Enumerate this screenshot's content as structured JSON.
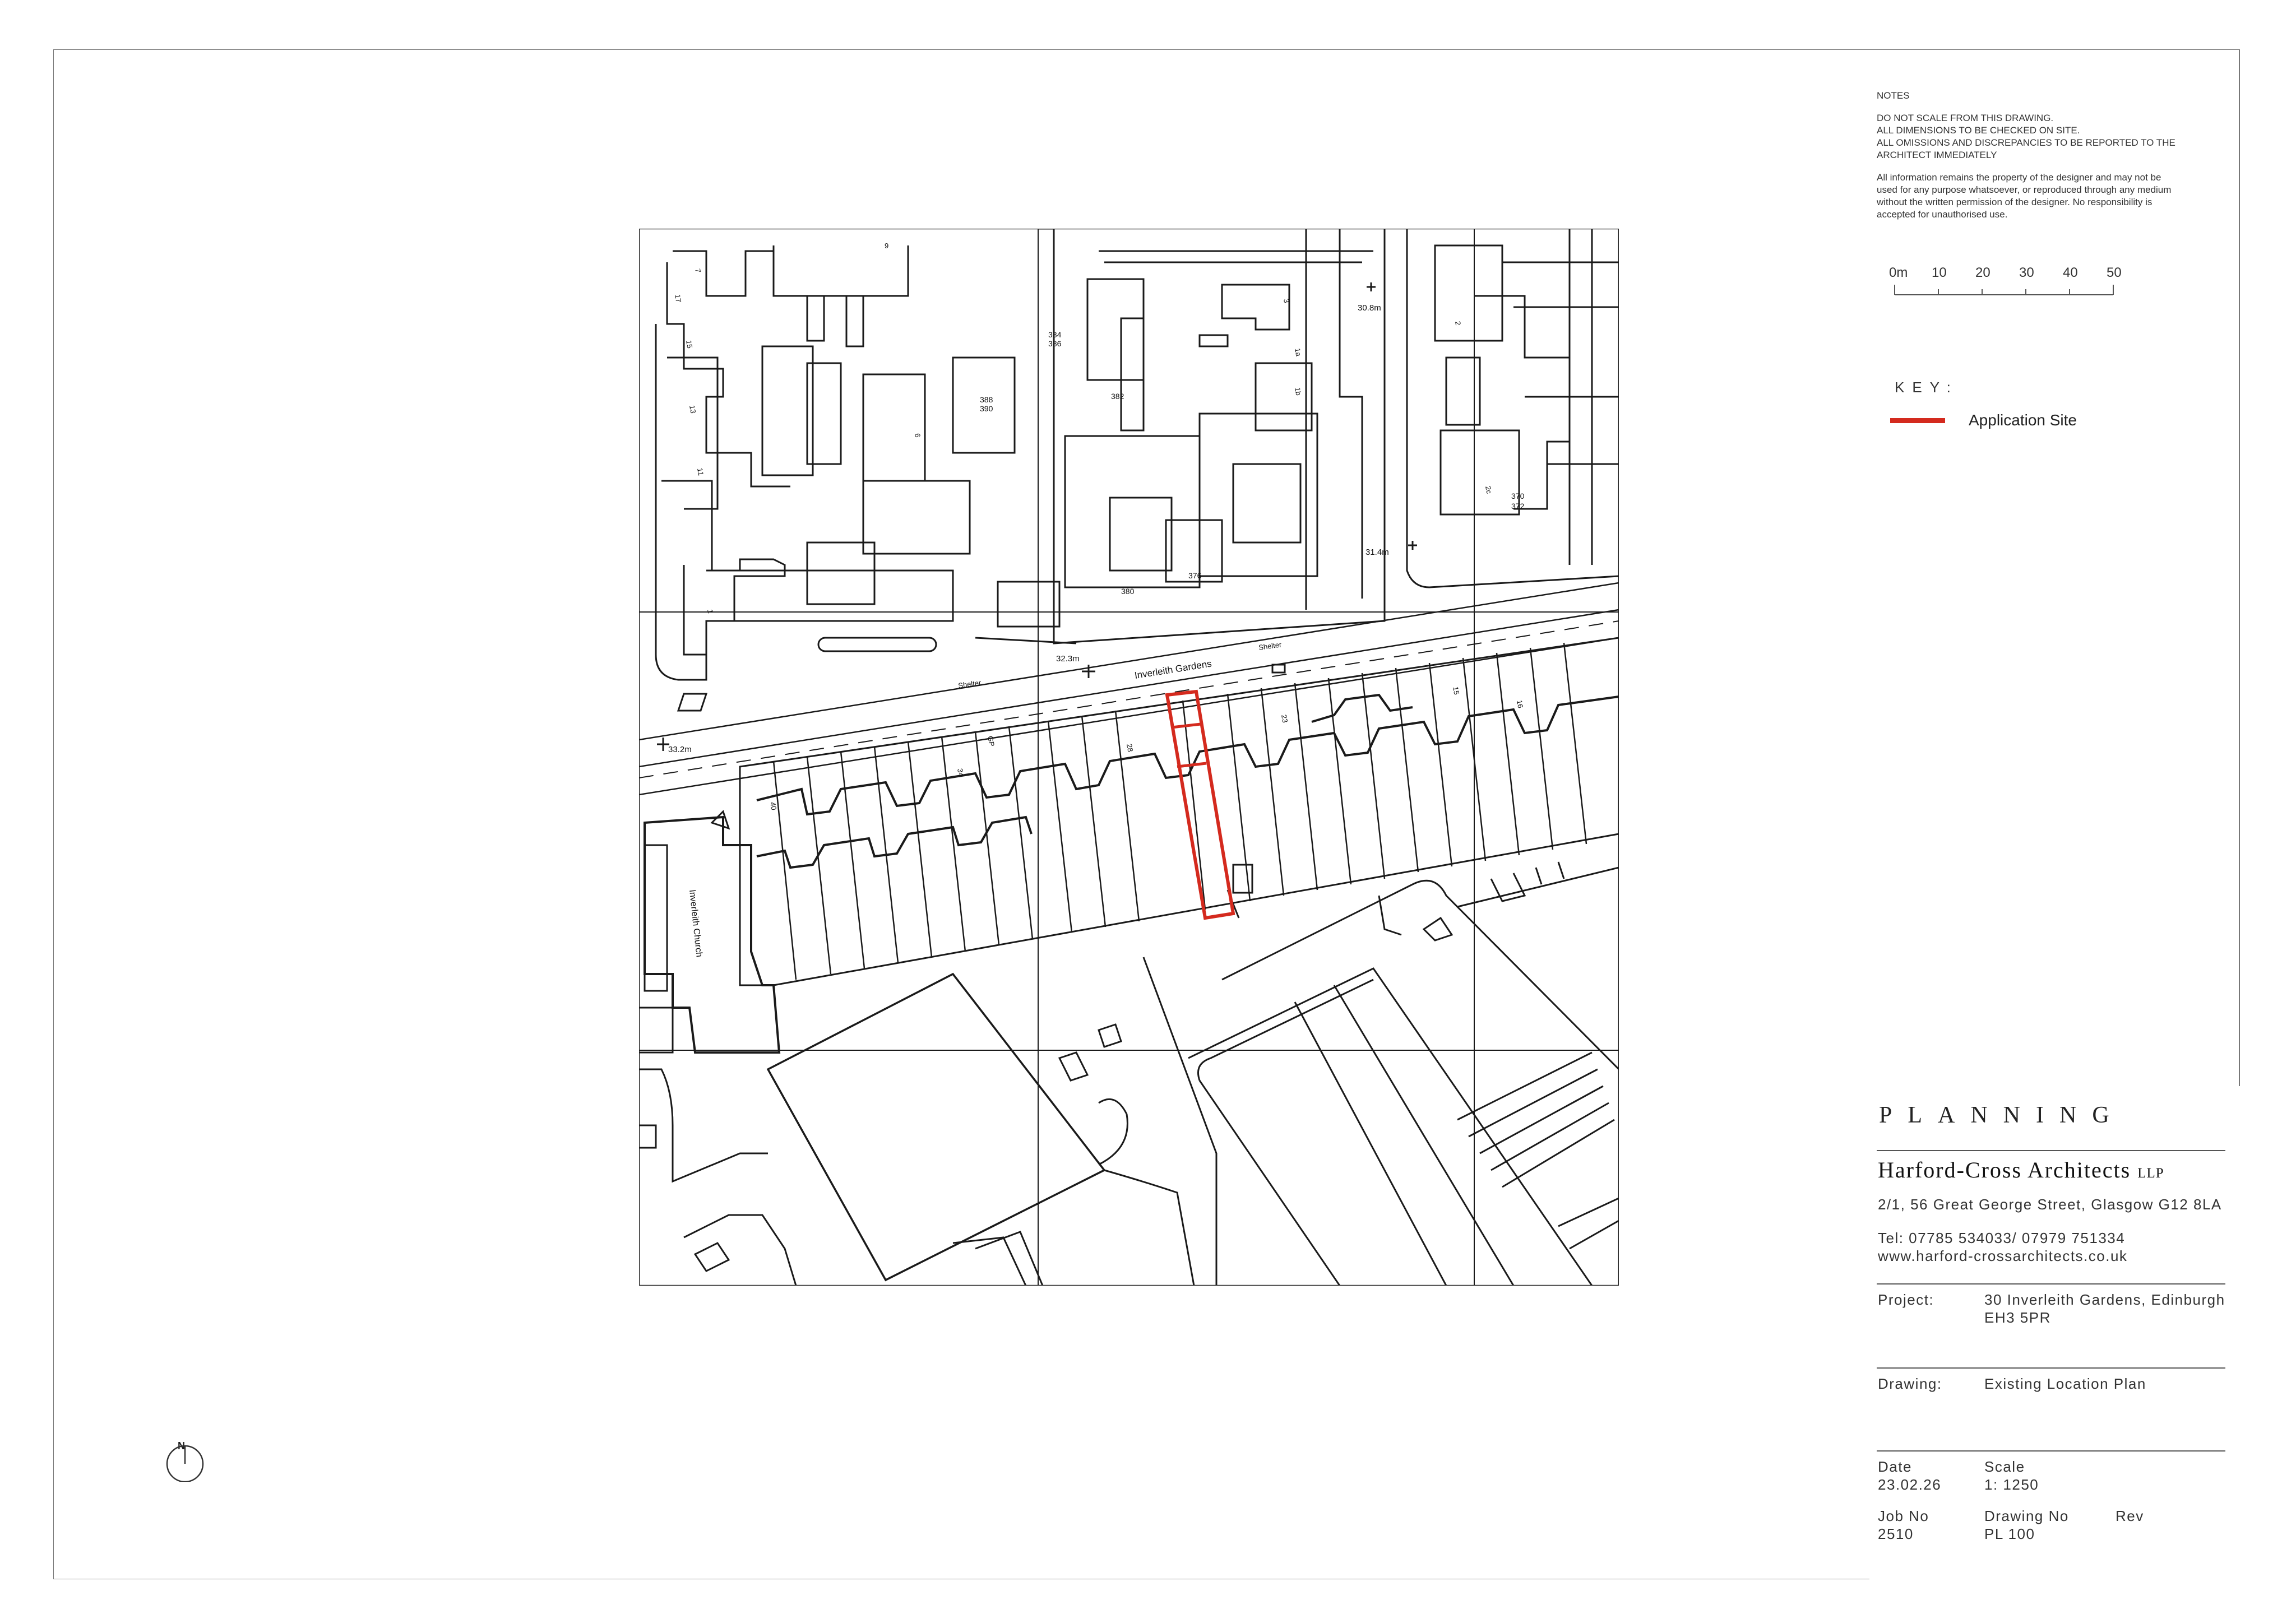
{
  "notes": {
    "heading": "NOTES",
    "warnings": [
      "DO NOT SCALE FROM THIS DRAWING.",
      "ALL DIMENSIONS TO BE CHECKED ON SITE.",
      "ALL OMISSIONS AND DISCREPANCIES TO BE REPORTED TO THE",
      "ARCHITECT IMMEDIATELY"
    ],
    "copyright": [
      "All information remains the property of the designer and may not be",
      "used for any purpose whatsoever, or reproduced through any medium",
      "without the written permission of the designer.    No responsibility is",
      "accepted for unauthorised use."
    ]
  },
  "scale_bar": {
    "ticks": [
      "0m",
      "10",
      "20",
      "30",
      "40",
      "50"
    ]
  },
  "key": {
    "title": "KEY:",
    "items": [
      {
        "label": "Application Site",
        "color": "#d42a1e"
      }
    ]
  },
  "map": {
    "street": "Inverleith Gardens",
    "church": "Inverleith Church",
    "spot_heights": [
      "30.8m",
      "31.4m",
      "32.3m",
      "33.2m"
    ],
    "shelters": [
      "Shelter",
      "Shelter"
    ],
    "house_numbers": [
      "9",
      "7",
      "3",
      "17",
      "15",
      "13",
      "11",
      "1",
      "6",
      "384",
      "386",
      "388",
      "390",
      "382",
      "380",
      "376",
      "1b",
      "1a",
      "2",
      "2c",
      "370",
      "372",
      "40",
      "34",
      "GP",
      "28",
      "23",
      "15",
      "16"
    ]
  },
  "north": {
    "label": "N"
  },
  "title_block": {
    "stage": "PLANNING",
    "firm": "Harford-Cross Architects",
    "firm_suffix": "LLP",
    "address": "2/1, 56 Great George Street, Glasgow G12 8LA",
    "tel": "Tel: 07785 534033/ 07979 751334",
    "web": "www.harford-crossarchitects.co.uk",
    "project_label": "Project:",
    "project_line1": "30 Inverleith Gardens, Edinburgh",
    "project_line2": "EH3 5PR",
    "drawing_label": "Drawing:",
    "drawing_value": "Existing Location Plan",
    "date_label": "Date",
    "date_value": "23.02.26",
    "scale_label": "Scale",
    "scale_value": "1: 1250",
    "jobno_label": "Job No",
    "jobno_value": "2510",
    "drawingno_label": "Drawing No",
    "drawingno_value": "PL 100",
    "rev_label": "Rev",
    "rev_value": ""
  }
}
